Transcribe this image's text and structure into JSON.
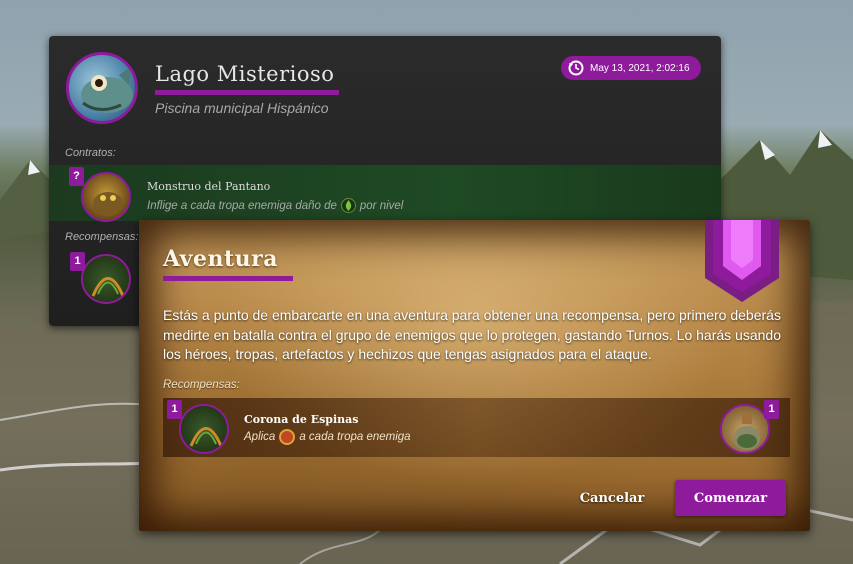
{
  "colors": {
    "accent": "#8e1b9c",
    "panel": "#232323",
    "parchment": "#b8894a",
    "contract_bg": "#1e4a24"
  },
  "location": {
    "title": "Lago Misterioso",
    "subtitle": "Piscina municipal Hispánico",
    "timestamp": "May 13, 2021, 2:02:16",
    "avatar_icon": "fish-icon",
    "contracts_label": "Contratos:",
    "contract": {
      "badge": "?",
      "name": "Monstruo del Pantano",
      "desc_before": "Inflige a cada tropa enemiga daño de",
      "desc_icon": "poison-drop-icon",
      "desc_after": "por nivel"
    },
    "rewards_label": "Recompensas:",
    "reward_badge": "1"
  },
  "dialog": {
    "title": "Aventura",
    "body": "Estás a punto de embarcarte en una aventura para obtener una recompensa, pero primero deberás medirte en batalla contra el grupo de enemigos que lo protegen, gastando Turnos. Lo harás usando los héroes, tropas, artefactos y hechizos que tengas asignados para el ataque.",
    "rewards_label": "Recompensas:",
    "reward": {
      "badge": "1",
      "name": "Corona de Espinas",
      "desc_before": "Aplica",
      "desc_icon": "thorns-status-icon",
      "desc_after": "a cada tropa enemiga",
      "item_badge": "1",
      "item_icon": "potion-flask-icon"
    },
    "cancel_label": "Cancelar",
    "start_label": "Comenzar"
  }
}
